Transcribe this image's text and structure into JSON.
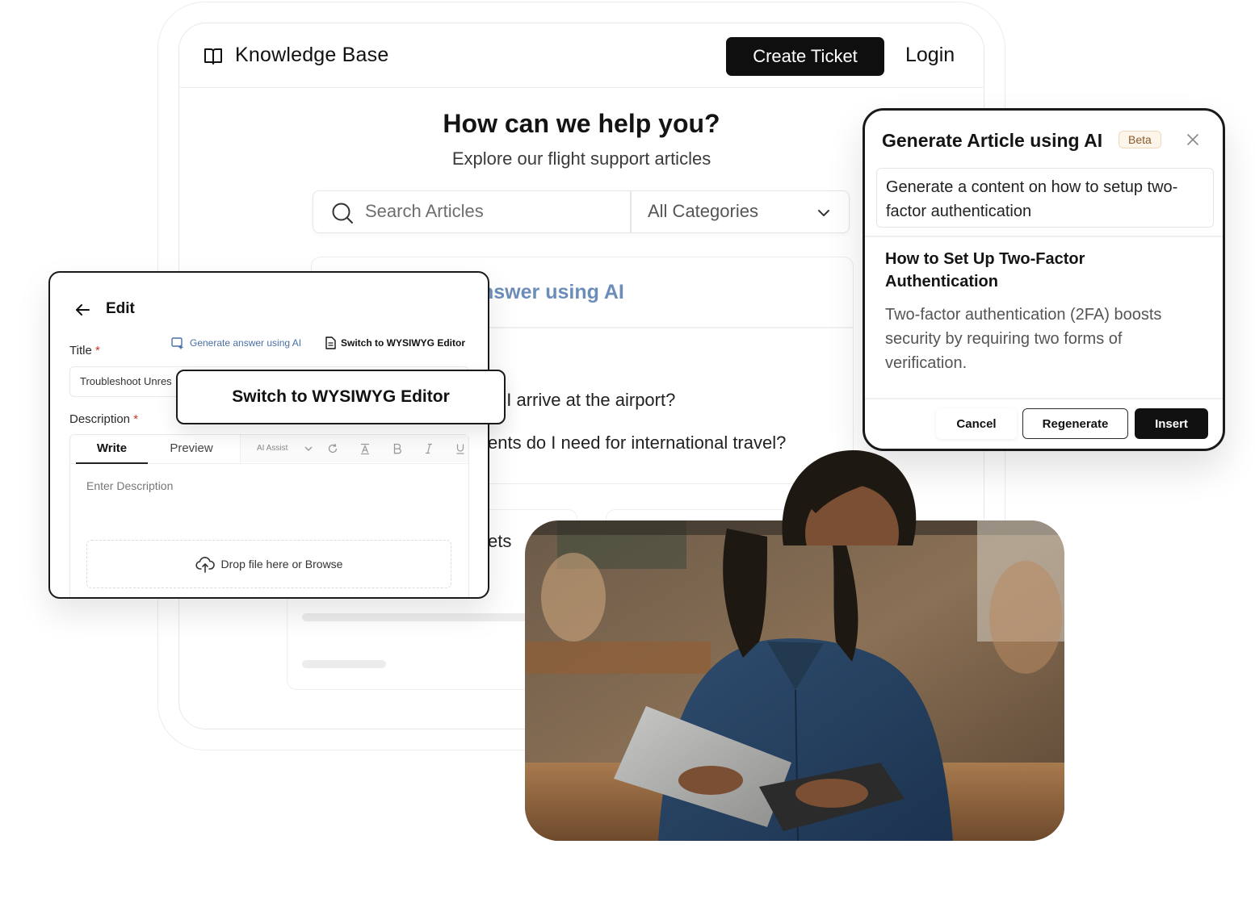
{
  "knowledge_base": {
    "title": "Knowledge Base",
    "create_ticket_label": "Create Ticket",
    "login_label": "Login",
    "hero_title": "How can we help you?",
    "hero_subtitle": "Explore our flight support articles",
    "search_placeholder": "Search Articles",
    "category_selected": "All Categories",
    "bg_ai_text": "nswer using AI",
    "bg_question_1": "ld I arrive at the airport?",
    "bg_question_2": "ents do I need for international travel?",
    "bg_card_fragment": "ets"
  },
  "edit_panel": {
    "title": "Edit",
    "title_label": "Title",
    "required_mark": "*",
    "generate_link": "Generate answer using AI",
    "switch_link": "Switch to WYSIWYG Editor",
    "title_value": "Troubleshoot Unres",
    "description_label": "Description",
    "tab_write": "Write",
    "tab_preview": "Preview",
    "ai_assist": "AI Assist",
    "description_placeholder": "Enter Description",
    "drop_text": "Drop file here or Browse"
  },
  "wysiwyg_popup": {
    "label": "Switch to WYSIWYG Editor"
  },
  "ai_modal": {
    "title": "Generate Article using AI",
    "badge": "Beta",
    "prompt": "Generate a content on how to setup two-factor authentication",
    "article_title": "How to Set Up Two-Factor Authentication",
    "article_body": "Two-factor authentication (2FA) boosts security by requiring two forms of verification.",
    "cancel_label": "Cancel",
    "regenerate_label": "Regenerate",
    "insert_label": "Insert"
  },
  "icons": [
    "book-icon",
    "search-icon",
    "chevron-down-icon",
    "back-arrow-icon",
    "ai-generate-icon",
    "document-icon",
    "refresh-icon",
    "text-color-icon",
    "bold-icon",
    "italic-icon",
    "underline-icon",
    "upload-cloud-icon",
    "close-icon"
  ],
  "colors": {
    "primary_button": "#0f0f0f",
    "ai_link": "#4a6fa5",
    "required": "#c0392b",
    "beta_text": "#8a5a2b",
    "beta_bg": "#fdf5ea"
  }
}
